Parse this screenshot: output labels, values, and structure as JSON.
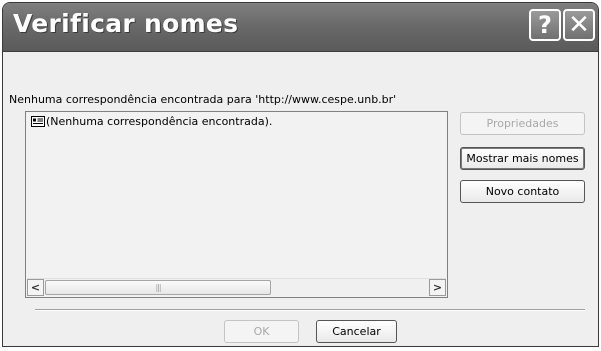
{
  "dialog": {
    "title": "Verificar nomes",
    "help_glyph": "?",
    "close_glyph": "✕",
    "message": "Nenhuma correspondência encontrada para 'http://www.cespe.unb.br'",
    "list": {
      "items": [
        {
          "icon": "address-card-icon",
          "label": "(Nenhuma correspondência encontrada)."
        }
      ]
    },
    "scrollbar": {
      "left_glyph": "<",
      "right_glyph": ">",
      "grip_glyph": "|||"
    },
    "buttons": {
      "properties": "Propriedades",
      "show_more_names": "Mostrar mais nomes",
      "new_contact": "Novo contato",
      "ok": "OK",
      "cancel": "Cancelar"
    }
  }
}
